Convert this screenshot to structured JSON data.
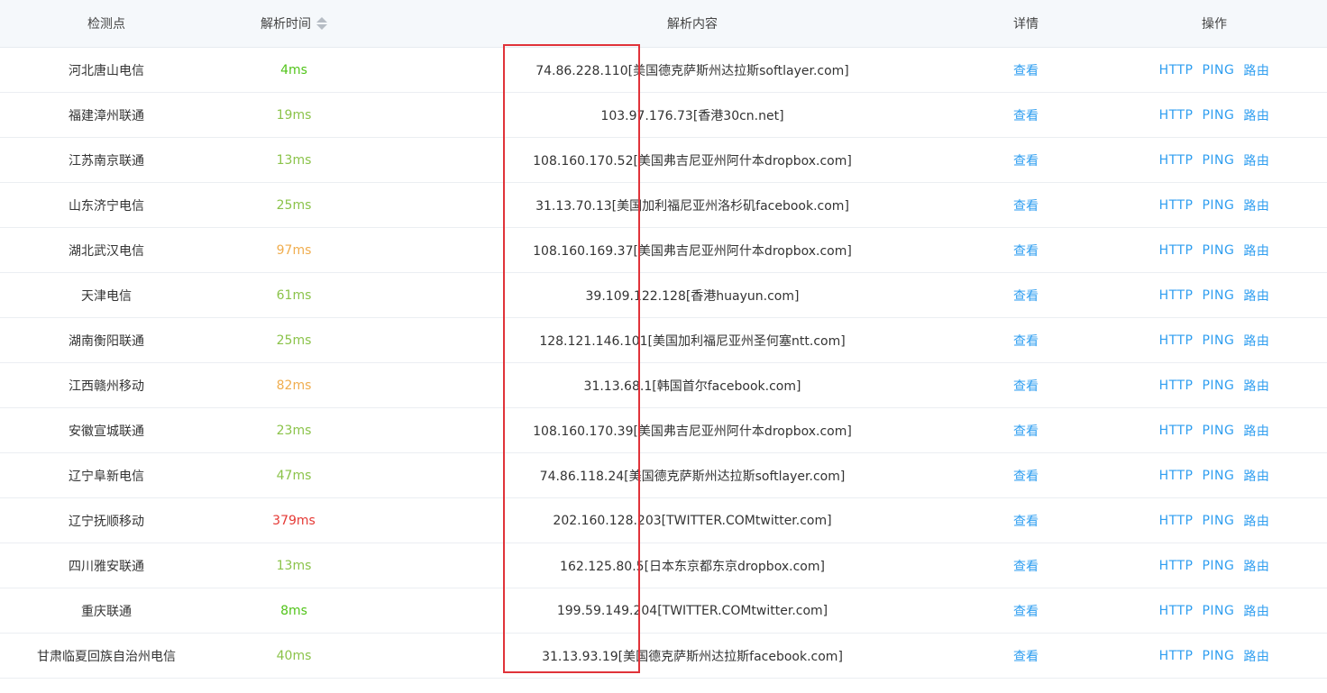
{
  "header": {
    "node": "检测点",
    "time": "解析时间",
    "content": "解析内容",
    "detail": "详情",
    "ops": "操作"
  },
  "colors": {
    "link": "#2f9ef0",
    "highlight_box": "#e0333a",
    "time_green": "#52c41a",
    "time_lightgreen": "#8bc34a",
    "time_orange": "#f0ad4e",
    "time_red": "#e53935"
  },
  "rows": [
    {
      "node": "河北唐山电信",
      "time": "4ms",
      "time_color": "#52c41a",
      "content": "74.86.228.110[美国德克萨斯州达拉斯softlayer.com]",
      "detail": "查看",
      "http": "HTTP",
      "ping": "PING",
      "route": "路由"
    },
    {
      "node": "福建漳州联通",
      "time": "19ms",
      "time_color": "#8bc34a",
      "content": "103.97.176.73[香港30cn.net]",
      "detail": "查看",
      "http": "HTTP",
      "ping": "PING",
      "route": "路由"
    },
    {
      "node": "江苏南京联通",
      "time": "13ms",
      "time_color": "#8bc34a",
      "content": "108.160.170.52[美国弗吉尼亚州阿什本dropbox.com]",
      "detail": "查看",
      "http": "HTTP",
      "ping": "PING",
      "route": "路由"
    },
    {
      "node": "山东济宁电信",
      "time": "25ms",
      "time_color": "#8bc34a",
      "content": "31.13.70.13[美国加利福尼亚州洛杉矶facebook.com]",
      "detail": "查看",
      "http": "HTTP",
      "ping": "PING",
      "route": "路由"
    },
    {
      "node": "湖北武汉电信",
      "time": "97ms",
      "time_color": "#f0ad4e",
      "content": "108.160.169.37[美国弗吉尼亚州阿什本dropbox.com]",
      "detail": "查看",
      "http": "HTTP",
      "ping": "PING",
      "route": "路由"
    },
    {
      "node": "天津电信",
      "time": "61ms",
      "time_color": "#8bc34a",
      "content": "39.109.122.128[香港huayun.com]",
      "detail": "查看",
      "http": "HTTP",
      "ping": "PING",
      "route": "路由"
    },
    {
      "node": "湖南衡阳联通",
      "time": "25ms",
      "time_color": "#8bc34a",
      "content": "128.121.146.101[美国加利福尼亚州圣何塞ntt.com]",
      "detail": "查看",
      "http": "HTTP",
      "ping": "PING",
      "route": "路由"
    },
    {
      "node": "江西赣州移动",
      "time": "82ms",
      "time_color": "#f0ad4e",
      "content": "31.13.68.1[韩国首尔facebook.com]",
      "detail": "查看",
      "http": "HTTP",
      "ping": "PING",
      "route": "路由"
    },
    {
      "node": "安徽宣城联通",
      "time": "23ms",
      "time_color": "#8bc34a",
      "content": "108.160.170.39[美国弗吉尼亚州阿什本dropbox.com]",
      "detail": "查看",
      "http": "HTTP",
      "ping": "PING",
      "route": "路由"
    },
    {
      "node": "辽宁阜新电信",
      "time": "47ms",
      "time_color": "#8bc34a",
      "content": "74.86.118.24[美国德克萨斯州达拉斯softlayer.com]",
      "detail": "查看",
      "http": "HTTP",
      "ping": "PING",
      "route": "路由"
    },
    {
      "node": "辽宁抚顺移动",
      "time": "379ms",
      "time_color": "#e53935",
      "content": "202.160.128.203[TWITTER.COMtwitter.com]",
      "detail": "查看",
      "http": "HTTP",
      "ping": "PING",
      "route": "路由"
    },
    {
      "node": "四川雅安联通",
      "time": "13ms",
      "time_color": "#8bc34a",
      "content": "162.125.80.5[日本东京都东京dropbox.com]",
      "detail": "查看",
      "http": "HTTP",
      "ping": "PING",
      "route": "路由"
    },
    {
      "node": "重庆联通",
      "time": "8ms",
      "time_color": "#52c41a",
      "content": "199.59.149.204[TWITTER.COMtwitter.com]",
      "detail": "查看",
      "http": "HTTP",
      "ping": "PING",
      "route": "路由"
    },
    {
      "node": "甘肃临夏回族自治州电信",
      "time": "40ms",
      "time_color": "#8bc34a",
      "content": "31.13.93.19[美国德克萨斯州达拉斯facebook.com]",
      "detail": "查看",
      "http": "HTTP",
      "ping": "PING",
      "route": "路由"
    }
  ]
}
